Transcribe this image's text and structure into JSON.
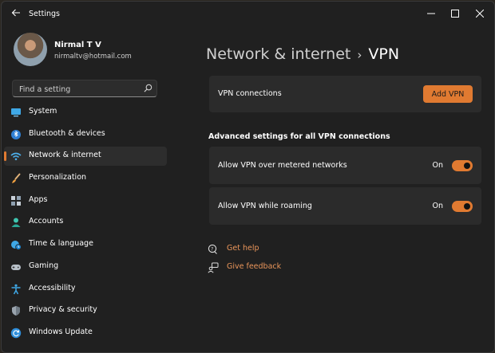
{
  "window": {
    "title": "Settings"
  },
  "user": {
    "name": "Nirmal T V",
    "email": "nirmaltv@hotmail.com"
  },
  "search": {
    "placeholder": "Find a setting"
  },
  "sidebar": {
    "items": [
      {
        "label": "System",
        "icon": "monitor-icon"
      },
      {
        "label": "Bluetooth & devices",
        "icon": "bluetooth-icon"
      },
      {
        "label": "Network & internet",
        "icon": "wifi-icon",
        "active": true
      },
      {
        "label": "Personalization",
        "icon": "brush-icon"
      },
      {
        "label": "Apps",
        "icon": "apps-icon"
      },
      {
        "label": "Accounts",
        "icon": "person-icon"
      },
      {
        "label": "Time & language",
        "icon": "globe-clock-icon"
      },
      {
        "label": "Gaming",
        "icon": "gamepad-icon"
      },
      {
        "label": "Accessibility",
        "icon": "accessibility-icon"
      },
      {
        "label": "Privacy & security",
        "icon": "shield-icon"
      },
      {
        "label": "Windows Update",
        "icon": "refresh-icon"
      }
    ]
  },
  "breadcrumb": {
    "parent": "Network & internet",
    "current": "VPN"
  },
  "vpn": {
    "connections_label": "VPN connections",
    "add_button": "Add VPN"
  },
  "advanced": {
    "heading": "Advanced settings for all VPN connections",
    "metered": {
      "label": "Allow VPN over metered networks",
      "state": "On"
    },
    "roaming": {
      "label": "Allow VPN while roaming",
      "state": "On"
    }
  },
  "help": {
    "get_help": "Get help",
    "give_feedback": "Give feedback"
  },
  "colors": {
    "accent": "#e07a31",
    "background": "#202020",
    "card": "#2b2b2b",
    "link": "#e9955a"
  }
}
